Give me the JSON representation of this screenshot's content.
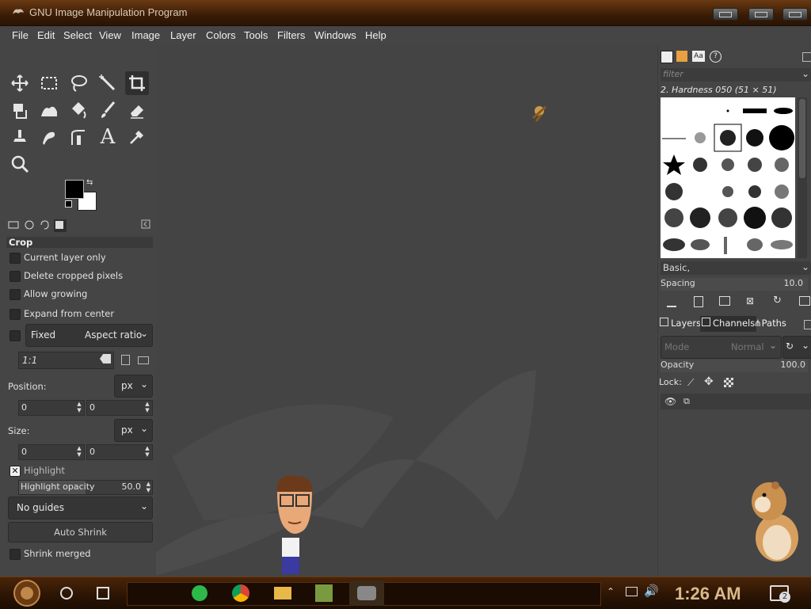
{
  "window": {
    "title": "GNU Image Manipulation Program"
  },
  "menu": [
    "File",
    "Edit",
    "Select",
    "View",
    "Image",
    "Layer",
    "Colors",
    "Tools",
    "Filters",
    "Windows",
    "Help"
  ],
  "tool_options": {
    "tool_name": "Crop",
    "current_layer_only": "Current layer only",
    "delete_cropped": "Delete cropped pixels",
    "allow_growing": "Allow growing",
    "expand_center": "Expand from center",
    "fixed": "Fixed",
    "aspect_ratio": "Aspect ratio",
    "ratio_value": "1:1",
    "position_label": "Position:",
    "position_unit": "px",
    "position_x": "0",
    "position_y": "0",
    "size_label": "Size:",
    "size_unit": "px",
    "size_w": "0",
    "size_h": "0",
    "highlight": "Highlight",
    "highlight_opacity_label": "Highlight opacity",
    "highlight_opacity_value": "50.0",
    "guides": "No guides",
    "auto_shrink": "Auto Shrink",
    "shrink_merged": "Shrink merged"
  },
  "brushes": {
    "filter_placeholder": "filter",
    "current": "2. Hardness 050 (51 × 51)",
    "tag": "Basic,",
    "spacing_label": "Spacing",
    "spacing_value": "10.0"
  },
  "layers": {
    "tab_layers": "Layers",
    "tab_channels": "Channels",
    "tab_paths": "Paths",
    "mode_label": "Mode",
    "mode_value": "Normal",
    "opacity_label": "Opacity",
    "opacity_value": "100.0",
    "lock_label": "Lock:"
  },
  "taskbar": {
    "clock": "1:26 AM",
    "notification_count": "2"
  },
  "colors": {
    "accent": "#d9b98a",
    "panel": "#454545",
    "titlebar": "#3a1c06"
  }
}
